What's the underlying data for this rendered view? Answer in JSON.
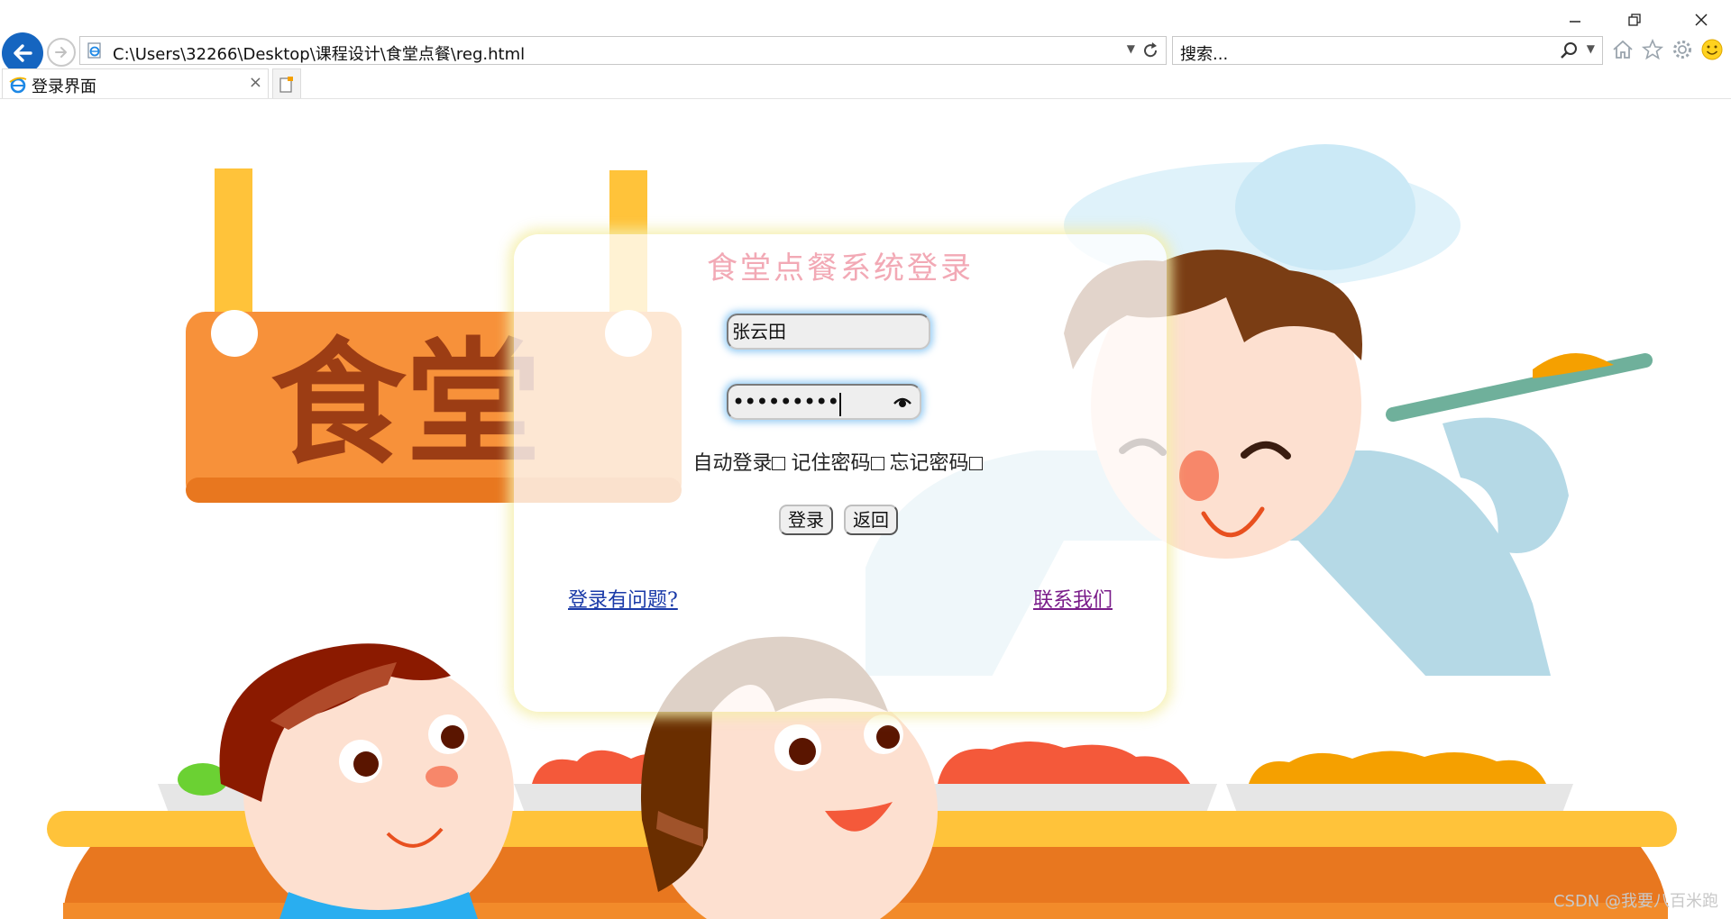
{
  "browser": {
    "address": "C:\\Users\\32266\\Desktop\\课程设计\\食堂点餐\\reg.html",
    "search_placeholder": "搜索...",
    "tab_title": "登录界面",
    "tab_close": "×",
    "icons": {
      "minimize": "minimize-icon",
      "restore": "restore-icon",
      "close": "close-icon",
      "back": "back-arrow-icon",
      "forward": "forward-arrow-icon",
      "refresh": "refresh-icon",
      "search": "search-icon",
      "home": "home-icon",
      "favorites": "star-icon",
      "tools": "gear-icon",
      "feedback": "smiley-icon"
    },
    "colors": {
      "back_button": "#1565c0",
      "ie_blue": "#1e88e5"
    }
  },
  "background": {
    "sign_text": "食堂",
    "colors": {
      "sign": "#f7913a",
      "sign_text": "#9c3d14",
      "post": "#ffc33a",
      "counter": "#e8771f",
      "counter_top": "#ffc33a",
      "chef_coat": "#b5d9e6",
      "hat": "#dff2fa",
      "hair_brown": "#7a3d14",
      "skin": "#fde0d0"
    }
  },
  "login": {
    "title": "食堂点餐系统登录",
    "username_value": "张云田",
    "password_masked": "•••••••••",
    "password_toggle_icon": "eye-icon",
    "options": [
      "自动登录",
      "记住密码",
      "忘记密码"
    ],
    "login_button": "登录",
    "back_button": "返回",
    "link_problem": "登录有问题?",
    "link_contact": "联系我们",
    "colors": {
      "title": "#f2a9b5",
      "link": "#1a3aa8",
      "visited_link": "#7a1d8a"
    }
  },
  "watermark": "CSDN @我要八百米跑"
}
